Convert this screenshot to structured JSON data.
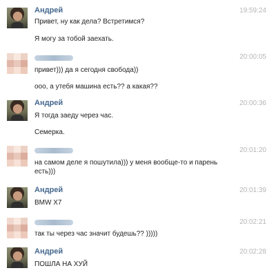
{
  "messages": [
    {
      "author": "Андрей",
      "time": "19:59:24",
      "lines": [
        "Привет, ну как дела? Встретимся?",
        "Я могу за тобой заехать."
      ]
    },
    {
      "author": "",
      "time": "20:00:05",
      "lines": [
        "привет))) да я сегодня свобода))",
        "ооо, а утебя машина есть?? а какая??"
      ]
    },
    {
      "author": "Андрей",
      "time": "20:00:36",
      "lines": [
        "Я тогда заеду через час.",
        "Семерка."
      ]
    },
    {
      "author": "",
      "time": "20:01:20",
      "lines": [
        "на самом деле я пошутила))) у меня вообще-то и парень",
        "есть)))"
      ]
    },
    {
      "author": "Андрей",
      "time": "20:01:39",
      "lines": [
        "BMW X7"
      ]
    },
    {
      "author": "",
      "time": "20:02:21",
      "lines": [
        "так ты через час значит будешь?? )))))"
      ]
    },
    {
      "author": "Андрей",
      "time": "20:02:28",
      "lines": [
        "ПОШЛА НА ХУЙ"
      ]
    }
  ]
}
